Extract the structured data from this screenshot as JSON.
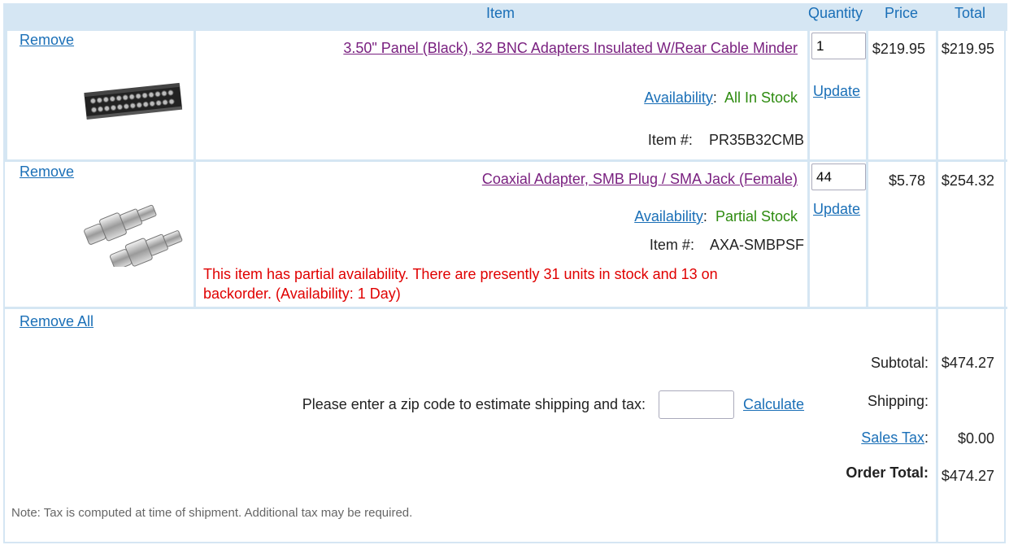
{
  "header": {
    "item": "Item",
    "quantity": "Quantity",
    "price": "Price",
    "total": "Total"
  },
  "rows": [
    {
      "remove": "Remove",
      "image_icon": "bnc-patch-panel-image",
      "name": "3.50\" Panel (Black), 32 BNC Adapters Insulated W/Rear Cable Minder",
      "availability_label": "Availability",
      "availability_value": "All In Stock",
      "item_num_label": "Item #:",
      "item_num": "PR35B32CMB",
      "qty": "1",
      "update": "Update",
      "price": "$219.95",
      "total": "$219.95",
      "note": ""
    },
    {
      "remove": "Remove",
      "image_icon": "coaxial-adapter-image",
      "name": "Coaxial Adapter, SMB Plug / SMA Jack (Female)",
      "availability_label": "Availability",
      "availability_value": "Partial Stock",
      "item_num_label": "Item #:",
      "item_num": "AXA-SMBPSF",
      "qty": "44",
      "update": "Update",
      "price": "$5.78",
      "total": "$254.32",
      "note_line1": "This item has partial availability. There are presently 31 units in stock and 13 on",
      "note_line2": "backorder. (Availability: 1 Day)"
    }
  ],
  "summary": {
    "remove_all": "Remove All",
    "zip_prompt": "Please enter a zip code to estimate shipping and tax:",
    "zip_value": "",
    "calculate": "Calculate",
    "subtotal_label": "Subtotal:",
    "subtotal_value": "$474.27",
    "shipping_label": "Shipping:",
    "shipping_value": "",
    "sales_tax_label": "Sales Tax",
    "sales_tax_value": "$0.00",
    "order_total_label": "Order Total:",
    "order_total_value": "$474.27",
    "tax_note": "Note: Tax is computed at time of shipment. Additional tax may be required."
  },
  "colors": {
    "header_bg": "#d5e6f3",
    "link": "#1a6fb7",
    "product_link": "#7a2180",
    "in_stock": "#2e8b10",
    "warning": "#e00000"
  }
}
